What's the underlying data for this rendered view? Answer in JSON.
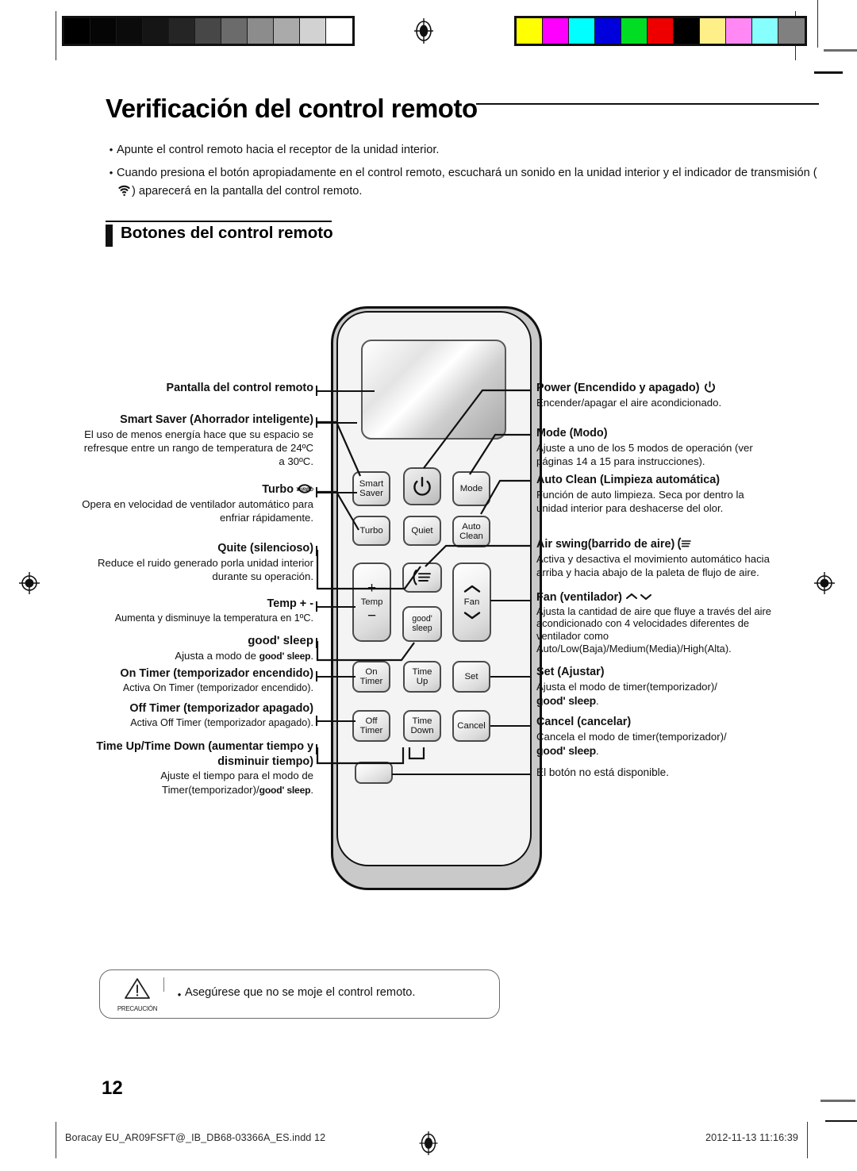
{
  "document": {
    "title": "Verificación del control remoto",
    "page_number": "12"
  },
  "intro": {
    "bullets": [
      "Apunte el control remoto hacia el receptor de la unidad interior.",
      "Cuando presiona el botón apropiadamente en el control remoto, escuchará un sonido en la unidad interior y el indicador de transmisión (   ) aparecerá en la pantalla del control remoto."
    ],
    "bullet2_part1": "Cuando presiona el botón apropiadamente en el control remoto, escuchará un sonido en la unidad interior y el indicador de",
    "bullet2_part2a": "transmisión (",
    "bullet2_part2b": ") aparecerá en la pantalla del control remoto.",
    "bullet_marker": "•"
  },
  "section": {
    "heading": "Botones del control remoto"
  },
  "callouts_left": [
    {
      "label": "Pantalla del control remoto",
      "desc": ""
    },
    {
      "label": "Smart Saver (Ahorrador inteligente)",
      "desc": "El uso de menos energía hace que su espacio se refresque entre un rango de temperatura de 24ºC a 30ºC."
    },
    {
      "label": "Turbo",
      "desc": "Opera en velocidad de ventilador automático para enfriar rápidamente.",
      "icon": "turbo-icon"
    },
    {
      "label": "Quite (silencioso)",
      "desc": "Reduce el ruido generado porla unidad interior durante su operación."
    },
    {
      "label": "Temp + -",
      "desc": "Aumenta y disminuye la temperatura en 1ºC."
    },
    {
      "label": "good' sleep",
      "desc_pre": "Ajusta a modo de ",
      "desc_gs": "good' sleep",
      "desc_post": "."
    },
    {
      "label": "On Timer (temporizador encendido)",
      "desc": "Activa On Timer (temporizador encendido)."
    },
    {
      "label": "Off Timer (temporizador apagado)",
      "desc": "Activa Off Timer (temporizador apagado)."
    },
    {
      "label": "Time Up/Time Down (aumentar tiempo y disminuir tiempo)",
      "desc_pre": "Ajuste el tiempo para el modo de Timer(temporizador)/",
      "desc_gs": "good' sleep",
      "desc_post": "."
    }
  ],
  "callouts_right": [
    {
      "label": "Power (Encendido y apagado)",
      "icon": "power-icon",
      "desc": "Encender/apagar el aire acondicionado."
    },
    {
      "label": "Mode (Modo)",
      "desc": "Ajuste a uno de los 5 modos de operación (ver páginas 14 a 15 para instrucciones)."
    },
    {
      "label": "Auto Clean (Limpieza automática)",
      "desc": "Función de auto limpieza. Seca por dentro la unidad interior para deshacerse del olor."
    },
    {
      "label": "Air swing(barrido de aire)",
      "icon": "air-swing-icon",
      "desc": "Activa y desactiva el movimiento automático hacia arriba y hacia abajo de la paleta de flujo de aire."
    },
    {
      "label": "Fan (ventilador)",
      "icon": "fan-chevrons-icon",
      "desc": "Ajusta la cantidad de aire que fluye a través del aire acondicionado con 4 velocidades diferentes de ventilador como Auto/Low(Baja)/Medium(Media)/High(Alta)."
    },
    {
      "label": "Set (Ajustar)",
      "desc_pre": "Ajusta el modo de timer(temporizador)/",
      "desc_gs": "good' sleep",
      "desc_post": "."
    },
    {
      "label": "Cancel (cancelar)",
      "desc_pre": "Cancela el modo de timer(temporizador)/",
      "desc_gs": "good' sleep",
      "desc_post": "."
    },
    {
      "label": "El botón no está disponible.",
      "desc": ""
    }
  ],
  "remote": {
    "buttons": {
      "smart_saver": "Smart\nSaver",
      "smart_saver_l1": "Smart",
      "smart_saver_l2": "Saver",
      "power": "",
      "mode": "Mode",
      "turbo": "Turbo",
      "quiet": "Quiet",
      "auto_clean_l1": "Auto",
      "auto_clean_l2": "Clean",
      "temp": "Temp",
      "temp_plus": "+",
      "temp_minus": "−",
      "air_swing": "",
      "good_sleep_l1": "good'",
      "good_sleep_l2": "sleep",
      "fan": "Fan",
      "on_timer_l1": "On",
      "on_timer_l2": "Timer",
      "time_up_l1": "Time",
      "time_up_l2": "Up",
      "set": "Set",
      "off_timer_l1": "Off",
      "off_timer_l2": "Timer",
      "time_down_l1": "Time",
      "time_down_l2": "Down",
      "cancel": "Cancel",
      "blank": ""
    }
  },
  "caution": {
    "label": "PRECAUCIÓN",
    "bullet_marker": "•",
    "text": "Asegúrese que no se moje el control remoto."
  },
  "footer": {
    "left": "Boracay EU_AR09FSFT@_IB_DB68-03366A_ES.indd   12",
    "right": "2012-11-13   11:16:39"
  },
  "colorbars": {
    "grayscale": [
      "#000000",
      "#050505",
      "#0b0b0b",
      "#151515",
      "#252525",
      "#474747",
      "#6b6b6b",
      "#8c8c8c",
      "#aaaaaa",
      "#d2d2d2",
      "#ffffff"
    ],
    "chromatic": [
      "#ffff00",
      "#ff00ff",
      "#00ffff",
      "#0000dd",
      "#00dd22",
      "#ee0000",
      "#000000",
      "#ffef88",
      "#ff88f5",
      "#88ffff",
      "#808080"
    ]
  }
}
